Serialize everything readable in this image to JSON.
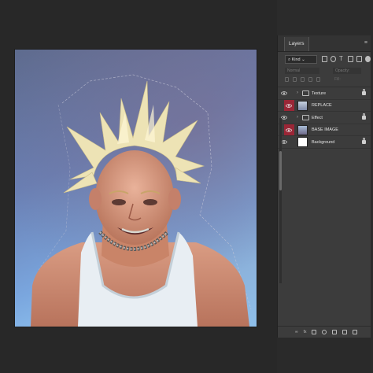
{
  "layers_panel": {
    "tab_label": "Layers",
    "filter_kind": "Kind",
    "blend_mode": "Normal",
    "opacity_label": "Opacity:",
    "fill_label": "Fill:",
    "layers": [
      {
        "name": "Texture",
        "type": "group",
        "locked": true,
        "visible": true
      },
      {
        "name": "REPLACE",
        "type": "smart-object",
        "locked": false,
        "visible": true
      },
      {
        "name": "Effect",
        "type": "group",
        "locked": true,
        "visible": true
      },
      {
        "name": "BASE IMAGE",
        "type": "smart-object",
        "locked": false,
        "visible": true
      },
      {
        "name": "Background",
        "type": "pixel",
        "locked": true,
        "visible": true
      }
    ]
  },
  "colors": {
    "workspace": "#2a2a2a",
    "panel": "#3c3c3c",
    "highlight": "#9a2636"
  },
  "footer_icons": [
    "link-icon",
    "fx-icon",
    "mask-icon",
    "adjustment-icon",
    "group-icon",
    "new-layer-icon",
    "trash-icon"
  ]
}
